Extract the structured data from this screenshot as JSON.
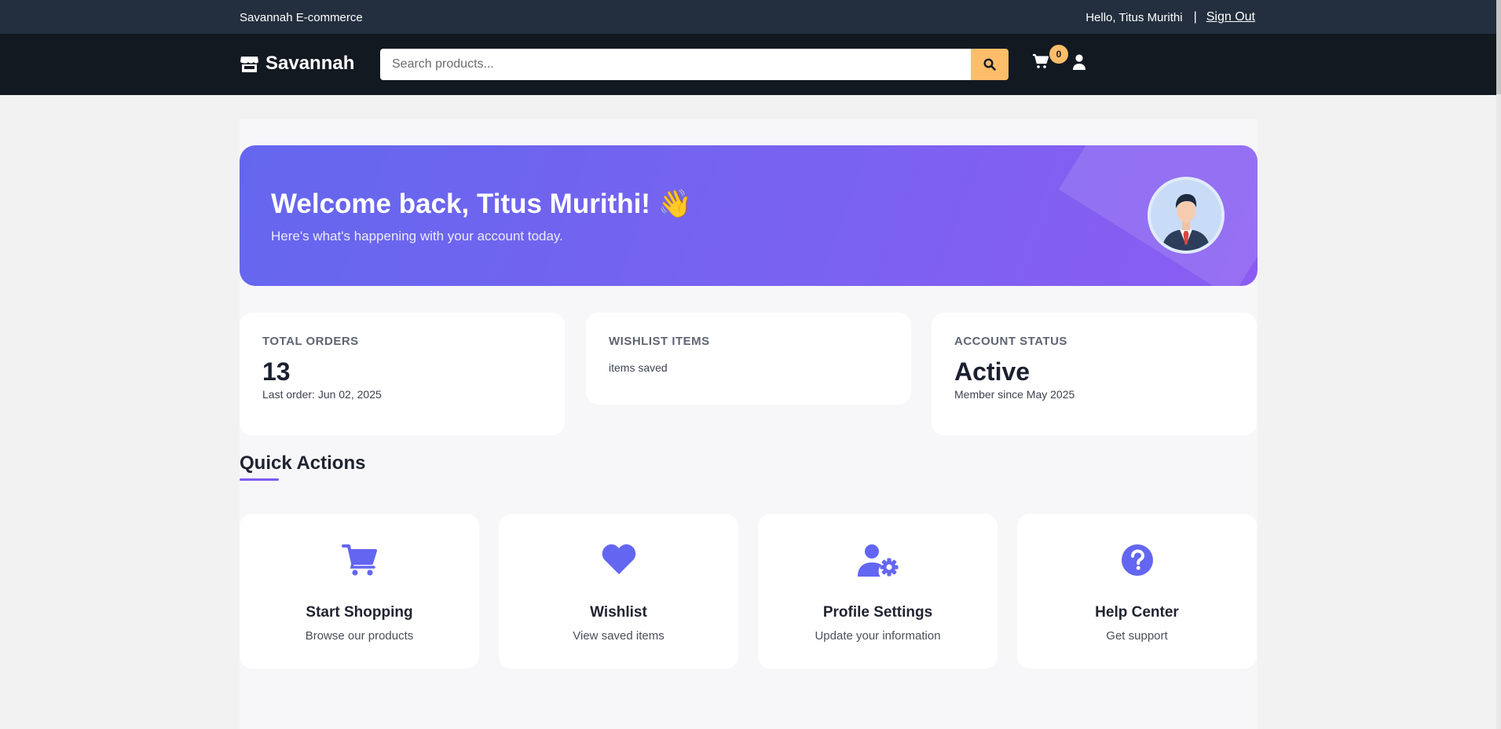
{
  "topbar": {
    "brand": "Savannah E-commerce",
    "greeting": "Hello, Titus Murithi",
    "separator": "|",
    "sign_out": "Sign Out"
  },
  "nav": {
    "logo": "Savannah",
    "search_placeholder": "Search products...",
    "cart_count": "0"
  },
  "hero": {
    "title": "Welcome back, Titus Murithi! 👋",
    "subtitle": "Here's what's happening with your account today."
  },
  "stats": [
    {
      "label": "TOTAL ORDERS",
      "value": "13",
      "sub": "Last order: Jun 02, 2025"
    },
    {
      "label": "WISHLIST ITEMS",
      "value": "",
      "sub": "items saved"
    },
    {
      "label": "ACCOUNT STATUS",
      "value": "Active",
      "sub": "Member since May 2025"
    }
  ],
  "quick_actions": {
    "title": "Quick Actions",
    "items": [
      {
        "title": "Start Shopping",
        "desc": "Browse our products",
        "icon": "cart-icon"
      },
      {
        "title": "Wishlist",
        "desc": "View saved items",
        "icon": "heart-icon"
      },
      {
        "title": "Profile Settings",
        "desc": "Update your information",
        "icon": "user-cog-icon"
      },
      {
        "title": "Help Center",
        "desc": "Get support",
        "icon": "question-icon"
      }
    ]
  },
  "colors": {
    "topbar": "#232f3e",
    "nav": "#131921",
    "accent": "#febd69",
    "primary": "#6366f1",
    "hero_gradient_end": "#8a5cf2"
  }
}
